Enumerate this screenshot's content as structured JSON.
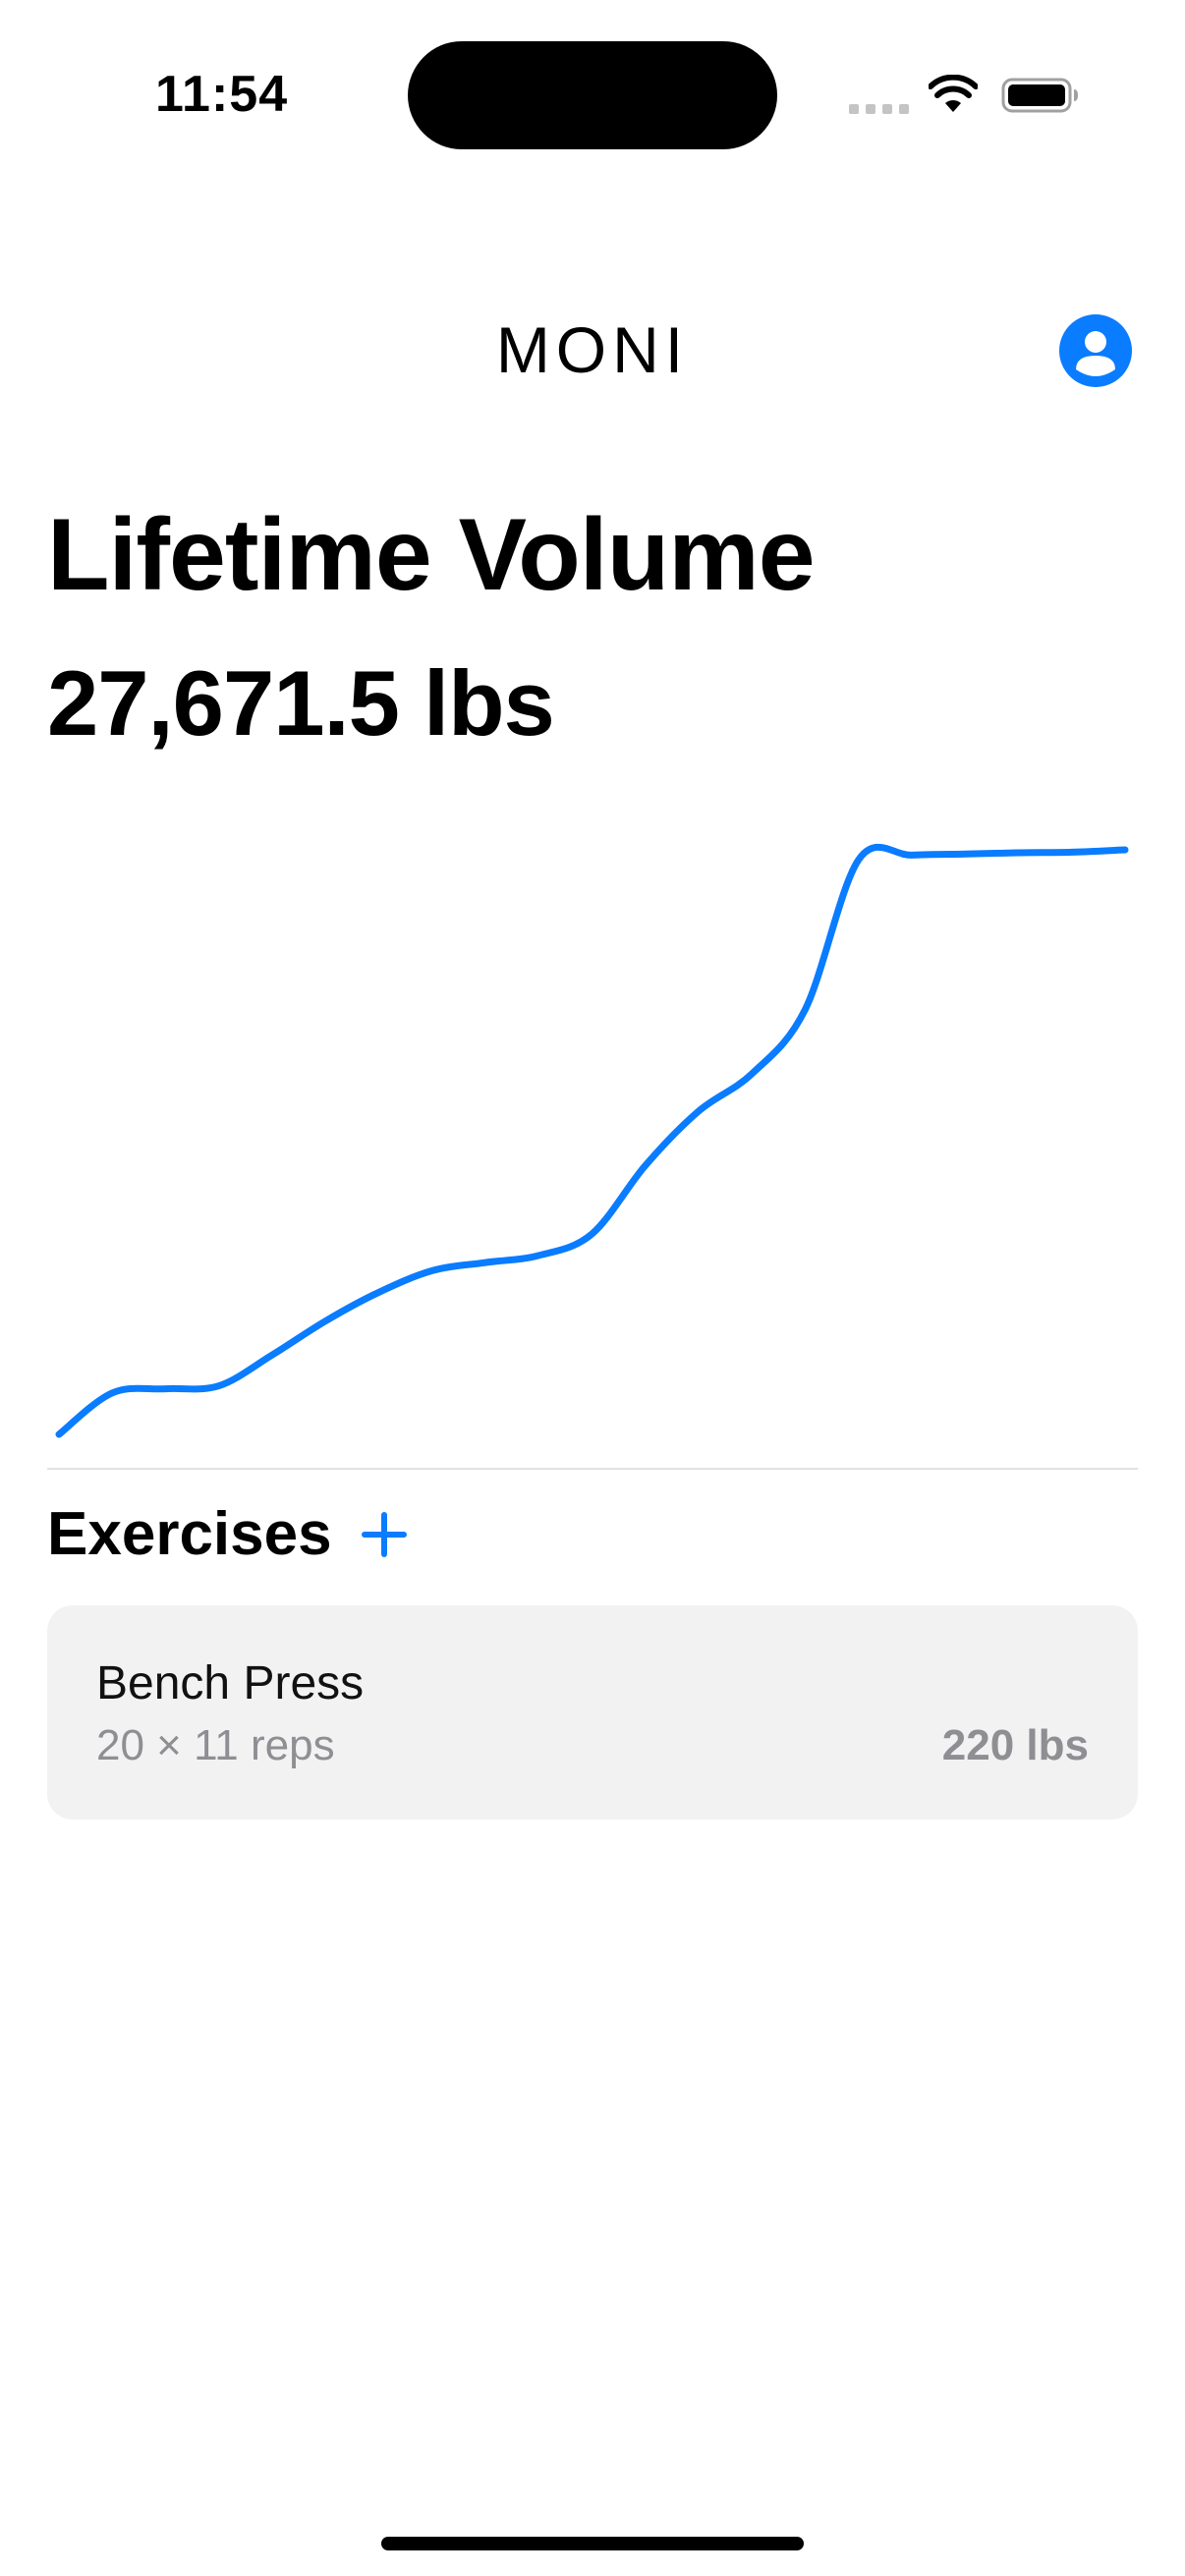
{
  "status_bar": {
    "time": "11:54"
  },
  "header": {
    "title": "MONI",
    "profile_icon": "person-circle-icon"
  },
  "summary": {
    "title": "Lifetime Volume",
    "total": "27,671.5 lbs"
  },
  "chart_data": {
    "type": "line",
    "title": "",
    "xlabel": "",
    "ylabel": "",
    "grid": false,
    "legend": "none",
    "color": "#0a7cff",
    "x": [
      0,
      1,
      2,
      3,
      4,
      5,
      6,
      7,
      8,
      9,
      10,
      11,
      12,
      13,
      14,
      15,
      16,
      17,
      18,
      19,
      20
    ],
    "series": [
      {
        "values": [
          0,
          7.1,
          7.8,
          8.3,
          13.6,
          19.4,
          24.3,
          28.0,
          29.4,
          30.6,
          34.3,
          46.0,
          55.3,
          61.7,
          72.7,
          98.3,
          99.1,
          99.3,
          99.5,
          99.6,
          100.0
        ]
      }
    ]
  },
  "exercises": {
    "title": "Exercises",
    "add_icon": "plus-icon",
    "items": [
      {
        "name": "Bench Press",
        "detail": "20 × 11 reps",
        "weight": "220 lbs"
      }
    ]
  }
}
